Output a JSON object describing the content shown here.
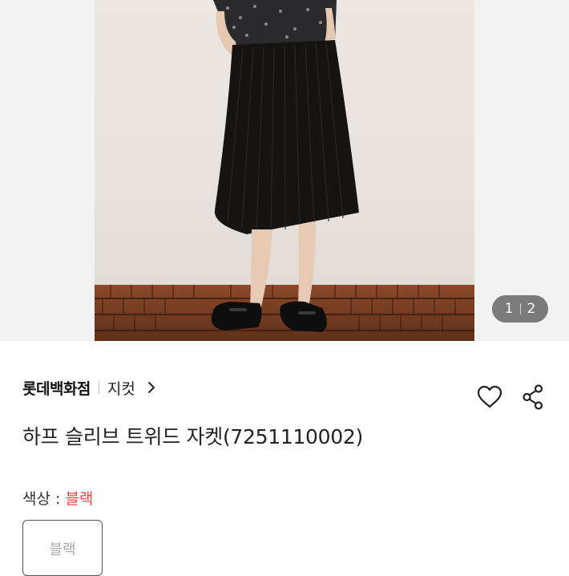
{
  "gallery": {
    "current_page": "1",
    "total_pages": "2"
  },
  "product": {
    "store_name": "롯데백화점",
    "category": "지컷",
    "title": "하프 슬리브 트위드 자켓(7251110002)"
  },
  "color_option": {
    "label": "색상 : ",
    "selected": "블랙",
    "options": [
      "블랙"
    ]
  },
  "icons": {
    "category_link": "chevron-right-icon",
    "wishlist": "heart-outline-icon",
    "share": "share-icon"
  },
  "colors": {
    "accent_red": "#e84545",
    "pager_bg": "#5a5a5a"
  }
}
